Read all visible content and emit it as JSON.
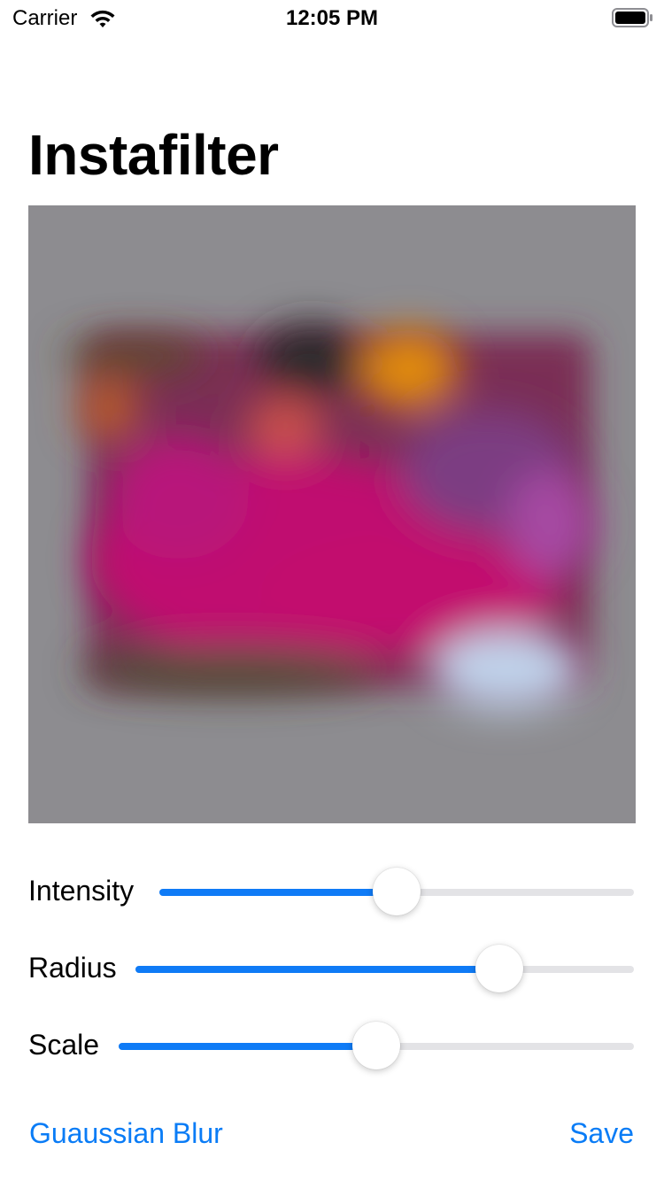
{
  "status_bar": {
    "carrier": "Carrier",
    "time": "12:05 PM",
    "icons": [
      "wifi-icon",
      "battery-icon"
    ]
  },
  "title": "Instafilter",
  "photo": {
    "subject": "blurred-flower-photo"
  },
  "sliders": [
    {
      "label": "Intensity",
      "value": 0.5
    },
    {
      "label": "Radius",
      "value": 0.73
    },
    {
      "label": "Scale",
      "value": 0.5
    }
  ],
  "toolbar": {
    "filter_label": "Guaussian Blur",
    "save_label": "Save"
  },
  "colors": {
    "accent": "#0f7bf6",
    "track": "#e3e3e6",
    "image_background": "#8d8c90"
  }
}
